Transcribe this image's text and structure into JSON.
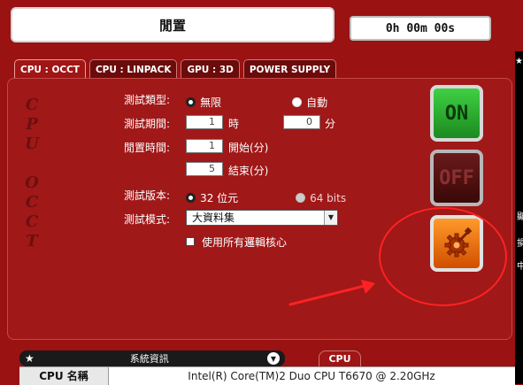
{
  "status": {
    "text": "閒置"
  },
  "timer": {
    "text": "0h 00m 00s"
  },
  "tabs": [
    {
      "label": "CPU : OCCT",
      "active": true
    },
    {
      "label": "CPU : LINPACK",
      "active": false
    },
    {
      "label": "GPU : 3D",
      "active": false
    },
    {
      "label": "POWER SUPPLY",
      "active": false
    }
  ],
  "side_label": [
    "C",
    "P",
    "U",
    "",
    "O",
    "C",
    "C",
    "T"
  ],
  "form": {
    "test_type": {
      "label": "測試類型:",
      "option_infinite": "無限",
      "option_auto": "自動",
      "selected": "無限"
    },
    "duration": {
      "label": "測試期間:",
      "hours": "1",
      "hours_unit": "時",
      "minutes": "0",
      "minutes_unit": "分"
    },
    "idle": {
      "label": "閒置時間:",
      "start": "1",
      "start_unit": "開始(分)",
      "end": "5",
      "end_unit": "結束(分)"
    },
    "version": {
      "label": "測試版本:",
      "option_32": "32 位元",
      "option_64": "64 bits",
      "selected": "32 位元"
    },
    "mode": {
      "label": "測試模式:",
      "selected": "大資料集"
    },
    "all_cores": {
      "label": "使用所有邏輯核心",
      "checked": false
    }
  },
  "buttons": {
    "on": "ON",
    "off": "OFF"
  },
  "bottom": {
    "sysinfo_label": "系統資訊",
    "cpu_tab": "CPU",
    "cpu_name_label": "CPU 名稱",
    "cpu_name_value": "Intel(R) Core(TM)2 Duo CPU T6670 @ 2.20GHz"
  },
  "side_chars": [
    "顯",
    "損",
    "中"
  ],
  "colors": {
    "background": "#9a1212",
    "on_green": "#2fb832",
    "gear_orange": "#f07a10",
    "annotation": "#ff2222"
  }
}
